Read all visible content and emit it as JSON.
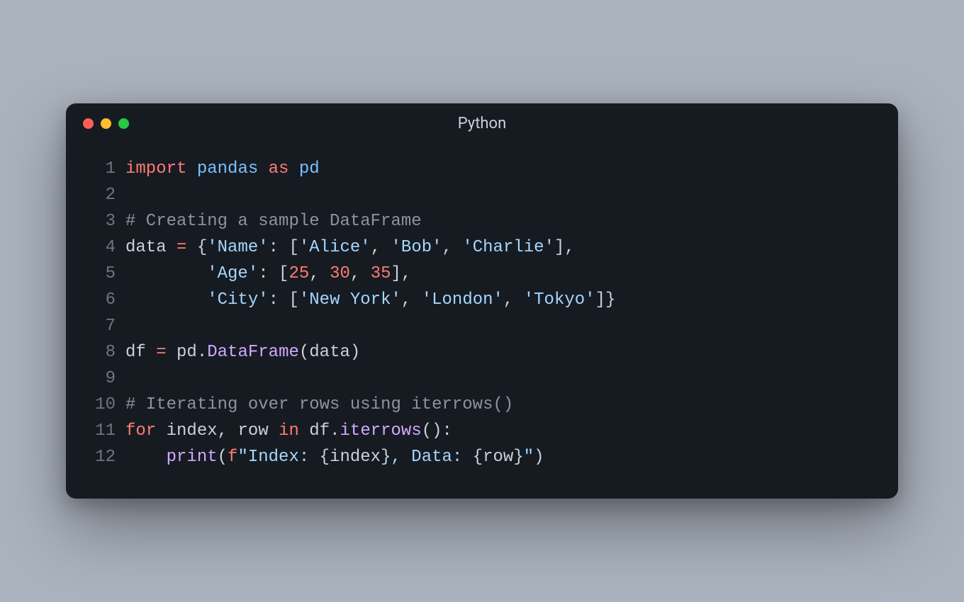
{
  "window": {
    "title": "Python",
    "traffic_lights": [
      "red",
      "yellow",
      "green"
    ]
  },
  "code": {
    "line_count": 12,
    "lines": {
      "l1": {
        "kw_import": "import",
        "module": "pandas",
        "kw_as": "as",
        "alias": "pd"
      },
      "l2": {
        "blank": ""
      },
      "l3": {
        "comment": "# Creating a sample DataFrame"
      },
      "l4": {
        "var": "data",
        "op": "=",
        "key": "'Name'",
        "v1": "'Alice'",
        "v2": "'Bob'",
        "v3": "'Charlie'"
      },
      "l5": {
        "key": "'Age'",
        "n1": "25",
        "n2": "30",
        "n3": "35"
      },
      "l6": {
        "key": "'City'",
        "v1": "'New York'",
        "v2": "'London'",
        "v3": "'Tokyo'"
      },
      "l7": {
        "blank": ""
      },
      "l8": {
        "var": "df",
        "op": "=",
        "obj": "pd",
        "cls": "DataFrame",
        "arg": "data"
      },
      "l9": {
        "blank": ""
      },
      "l10": {
        "comment": "# Iterating over rows using iterrows()"
      },
      "l11": {
        "kw_for": "for",
        "i": "index",
        "r": "row",
        "kw_in": "in",
        "obj": "df",
        "meth": "iterrows"
      },
      "l12": {
        "fn": "print",
        "fprefix": "f",
        "s1": "\"Index: ",
        "e1": "{index}",
        "s2": ", Data: ",
        "e2": "{row}",
        "s3": "\""
      }
    },
    "gutter": {
      "g1": "1",
      "g2": "2",
      "g3": "3",
      "g4": "4",
      "g5": "5",
      "g6": "6",
      "g7": "7",
      "g8": "8",
      "g9": "9",
      "g10": "10",
      "g11": "11",
      "g12": "12"
    }
  }
}
